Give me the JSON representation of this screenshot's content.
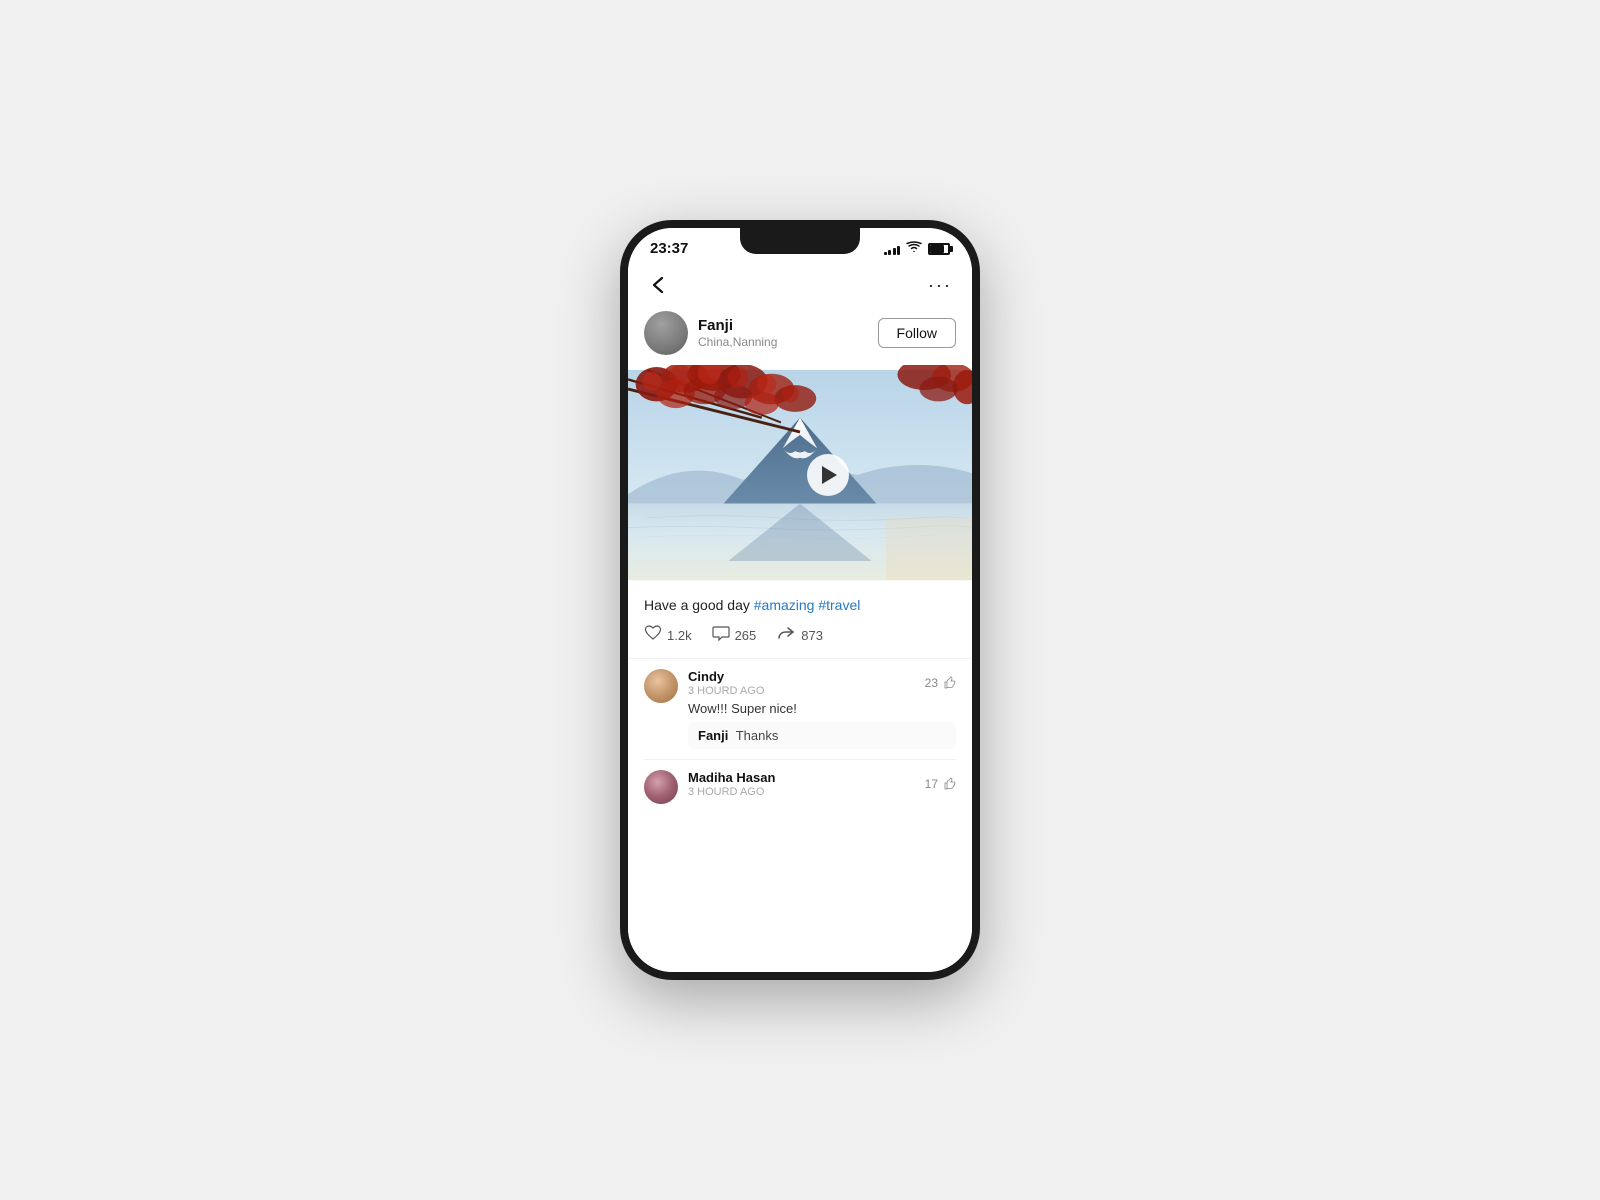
{
  "status": {
    "time": "23:37",
    "signal": [
      3,
      5,
      7,
      9,
      11
    ],
    "battery_level": 80
  },
  "nav": {
    "back_label": "←",
    "more_label": "···"
  },
  "profile": {
    "name": "Fanji",
    "location": "China,Nanning",
    "follow_label": "Follow"
  },
  "post": {
    "caption": "Have a good day",
    "hashtags": [
      "#amazing",
      "#travel"
    ],
    "likes": "1.2k",
    "comments": "265",
    "shares": "873"
  },
  "comments": [
    {
      "user": "Cindy",
      "time": "3 HOURD AGO",
      "text": "Wow!!!  Super nice!",
      "likes": "23",
      "reply": {
        "author": "Fanji",
        "text": "Thanks"
      }
    },
    {
      "user": "Madiha Hasan",
      "time": "3 HOURD AGO",
      "text": "",
      "likes": "17",
      "reply": null
    }
  ]
}
